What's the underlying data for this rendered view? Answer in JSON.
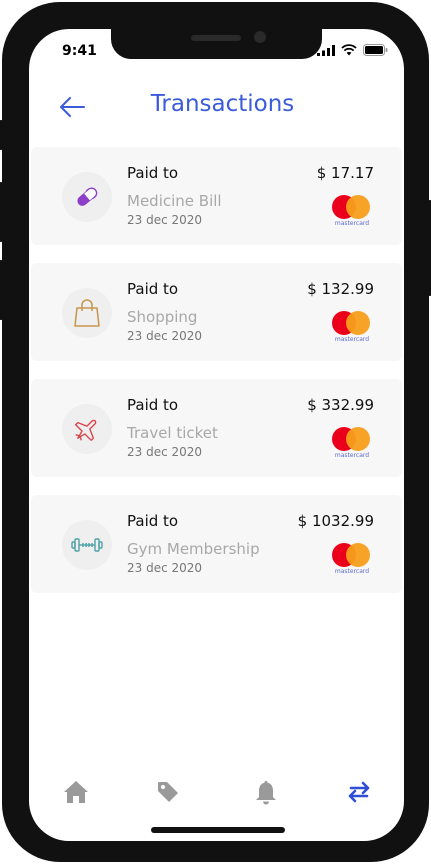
{
  "status_bar": {
    "time": "9:41"
  },
  "header": {
    "title": "Transactions"
  },
  "transactions": [
    {
      "paid_label": "Paid to",
      "merchant": "Medicine Bill",
      "date": "23 dec 2020",
      "amount": "$ 17.17",
      "icon": "pill-icon",
      "card_brand": "mastercard"
    },
    {
      "paid_label": "Paid to",
      "merchant": "Shopping",
      "date": "23 dec 2020",
      "amount": "$ 132.99",
      "icon": "shopping-bag-icon",
      "card_brand": "mastercard"
    },
    {
      "paid_label": "Paid to",
      "merchant": "Travel ticket",
      "date": "23 dec 2020",
      "amount": "$ 332.99",
      "icon": "airplane-icon",
      "card_brand": "mastercard"
    },
    {
      "paid_label": "Paid to",
      "merchant": "Gym Membership",
      "date": "23 dec 2020",
      "amount": "$ 1032.99",
      "icon": "dumbbell-icon",
      "card_brand": "mastercard"
    }
  ],
  "bottom_nav": [
    {
      "icon": "home-icon",
      "active": false
    },
    {
      "icon": "tag-icon",
      "active": false
    },
    {
      "icon": "bell-icon",
      "active": false
    },
    {
      "icon": "transfer-icon",
      "active": true
    }
  ],
  "colors": {
    "accent": "#3b5bdb",
    "card_bg": "#f7f7f7",
    "pill": "#8e3fc8",
    "bag": "#c8954c",
    "plane": "#d9474e",
    "dumbbell": "#4fa3a8",
    "nav_inactive": "#9a9a9a"
  }
}
